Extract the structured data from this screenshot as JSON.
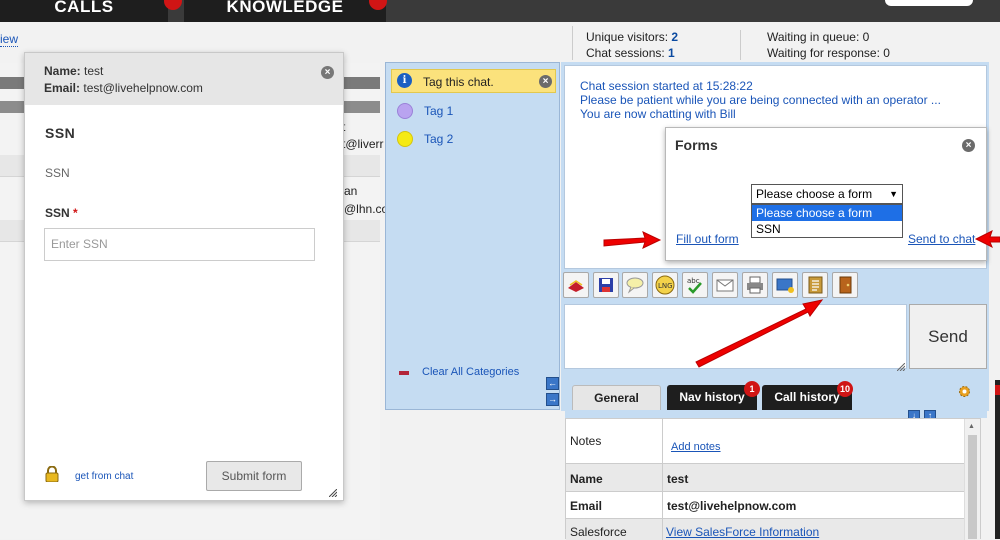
{
  "topnav": {
    "tab_calls": "CALLS",
    "tab_knowledge": "KNOWLEDGE",
    "left_link": "iew"
  },
  "stats": {
    "unique_visitors_label": "Unique visitors:",
    "unique_visitors_value": "2",
    "chat_sessions_label": "Chat sessions:",
    "chat_sessions_value": "1",
    "waiting_queue": "Waiting in queue: 0",
    "waiting_response": "Waiting for response: 0"
  },
  "bg_table": {
    "frag1": "t",
    "frag2": "t@liverr",
    "frag3": "an",
    "frag4": "@lhn.co"
  },
  "form_panel": {
    "name_label": "Name:",
    "name_value": "test",
    "email_label": "Email:",
    "email_value": "test@livehelpnow.com",
    "form_title": "SSN",
    "description": "SSN",
    "field_label": "SSN",
    "required_mark": "*",
    "field_placeholder": "Enter SSN",
    "get_from_chat": "get from chat",
    "submit": "Submit form"
  },
  "tags": {
    "header": "Tag this chat.",
    "items": [
      {
        "label": "Tag 1",
        "color": "#b9a3f0"
      },
      {
        "label": "Tag 2",
        "color": "#f5ea14"
      }
    ],
    "clear": "Clear All Categories"
  },
  "chat": {
    "lines": [
      "Chat session started at 15:28:22",
      "Please be patient while you are being connected with an operator ...",
      "You are now chatting with Bill"
    ],
    "send": "Send"
  },
  "forms_popup": {
    "title": "Forms",
    "selected": "Please choose a form",
    "options": [
      "Please choose a form",
      "SSN"
    ],
    "fill_out": "Fill out form",
    "send_to_chat": "Send to chat"
  },
  "toolbar_icons": [
    "transfer-icon",
    "save-icon",
    "canned-icon",
    "language-icon",
    "spellcheck-icon",
    "email-icon",
    "print-icon",
    "screenshot-icon",
    "forms-icon",
    "end-chat-icon"
  ],
  "tabs": [
    {
      "label": "General",
      "badge": ""
    },
    {
      "label": "Nav history",
      "badge": "1"
    },
    {
      "label": "Call history",
      "badge": "10"
    }
  ],
  "info": {
    "notes_label": "Notes",
    "add_notes": "Add notes",
    "name_label": "Name",
    "name_value": "test",
    "email_label": "Email",
    "email_value": "test@livehelpnow.com",
    "salesforce_label": "Salesforce",
    "salesforce_link": "View SalesForce Information"
  }
}
